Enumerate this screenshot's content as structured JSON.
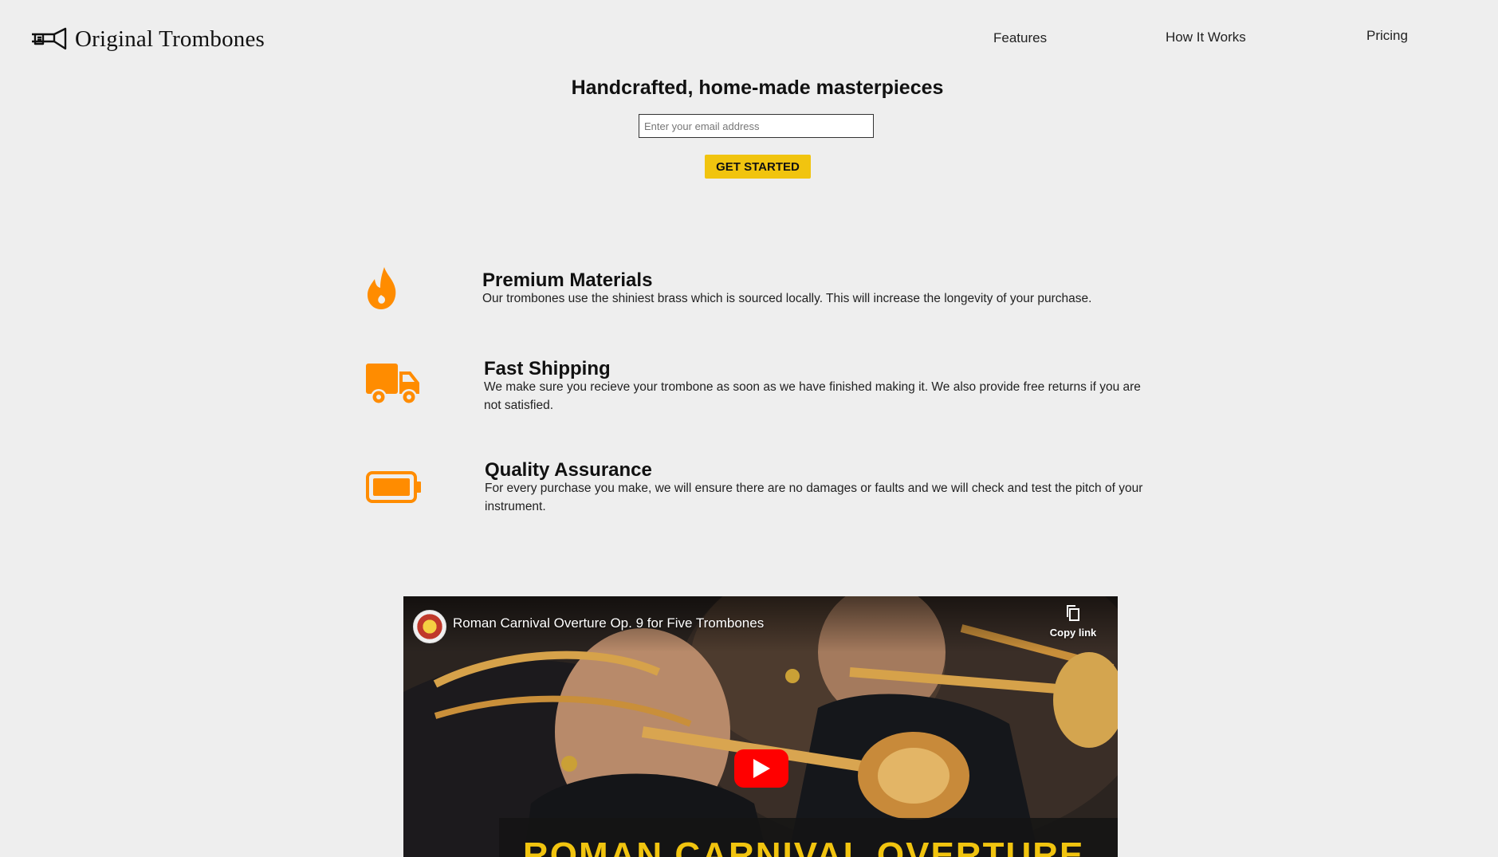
{
  "header": {
    "brand": "Original Trombones",
    "logo_icon": "trombone-icon",
    "nav": [
      {
        "label": "Features"
      },
      {
        "label": "How It Works"
      },
      {
        "label": "Pricing"
      }
    ]
  },
  "hero": {
    "title": "Handcrafted, home-made masterpieces",
    "email_placeholder": "Enter your email address",
    "cta_label": "GET STARTED"
  },
  "colors": {
    "accent": "#f1c40f",
    "icon": "#ff8c00",
    "background": "#eeeeee"
  },
  "features": [
    {
      "icon": "fire-icon",
      "title": "Premium Materials",
      "text": "Our trombones use the shiniest brass which is sourced locally. This will increase the longevity of your purchase."
    },
    {
      "icon": "truck-icon",
      "title": "Fast Shipping",
      "text": "We make sure you recieve your trombone as soon as we have finished making it. We also provide free returns if you are not satisfied."
    },
    {
      "icon": "battery-icon",
      "title": "Quality Assurance",
      "text": "For every purchase you make, we will ensure there are no damages or faults and we will check and test the pitch of your instrument."
    }
  ],
  "video": {
    "title": "Roman Carnival Overture Op. 9 for Five Trombones",
    "copy_label": "Copy link",
    "banner_text": "ROMAN CARNIVAL OVERTURE"
  }
}
